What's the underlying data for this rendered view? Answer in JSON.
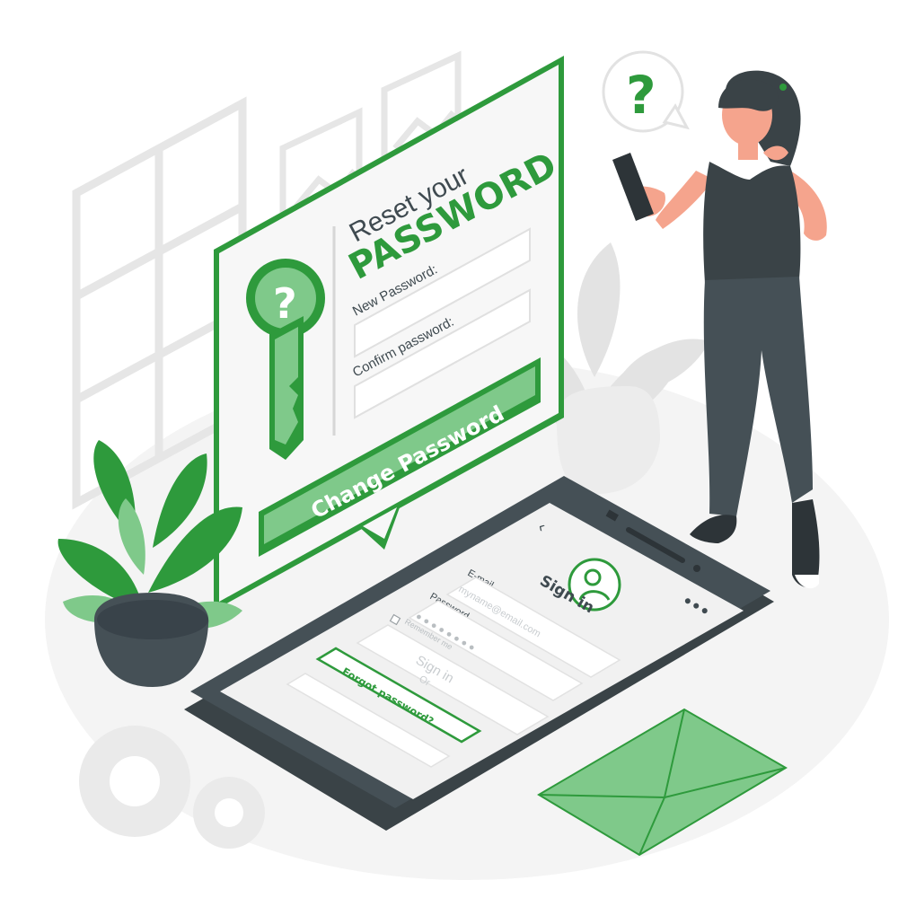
{
  "reset_card": {
    "title_line1": "Reset your",
    "title_line2": "PASSWORD",
    "new_password_label": "New Password:",
    "confirm_password_label": "Confirm password:",
    "submit_label": "Change Password",
    "key_symbol": "?"
  },
  "signin_screen": {
    "back_glyph": "‹",
    "title": "Sign in",
    "email_label": "E-mail",
    "email_placeholder": "myname@email.com",
    "password_label": "Password",
    "password_mask": "● ● ● ● ● ● ● ●",
    "remember_label": "Remember me",
    "signin_button_label": "Sign in",
    "or_label": "Or",
    "forgot_label": "Forgot password?",
    "menu_glyph": "•••"
  },
  "speech_bubble": {
    "symbol": "?"
  },
  "colors": {
    "accent": "#2e9a3c",
    "accent_light": "#7fc98a",
    "dark": "#455056",
    "figure_dark": "#3a4347",
    "skin": "#f5a48d"
  }
}
